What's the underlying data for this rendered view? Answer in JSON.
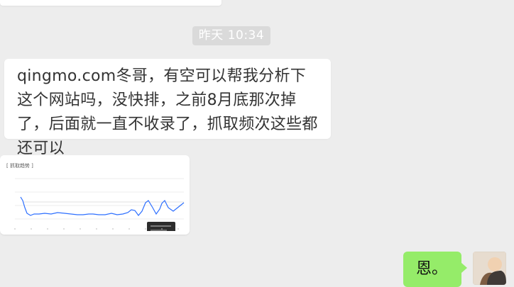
{
  "conversation": {
    "timestamp": "昨天 10:34",
    "incoming_message": {
      "text": "qingmo.com冬哥，有空可以帮我分析下这个网站吗，没快排，之前8月底那次掉了，后面就一直不收录了，抓取频次这些都还可以"
    },
    "image_preview": {
      "title": "[ 抓取趋势 ]"
    },
    "outgoing_message": {
      "text": "恩。"
    }
  },
  "colors": {
    "background": "#ededed",
    "incoming_bubble": "#ffffff",
    "outgoing_bubble": "#95ec69",
    "timestamp_bg": "#dadada"
  },
  "icons": {
    "avatar": "profile-photo"
  }
}
